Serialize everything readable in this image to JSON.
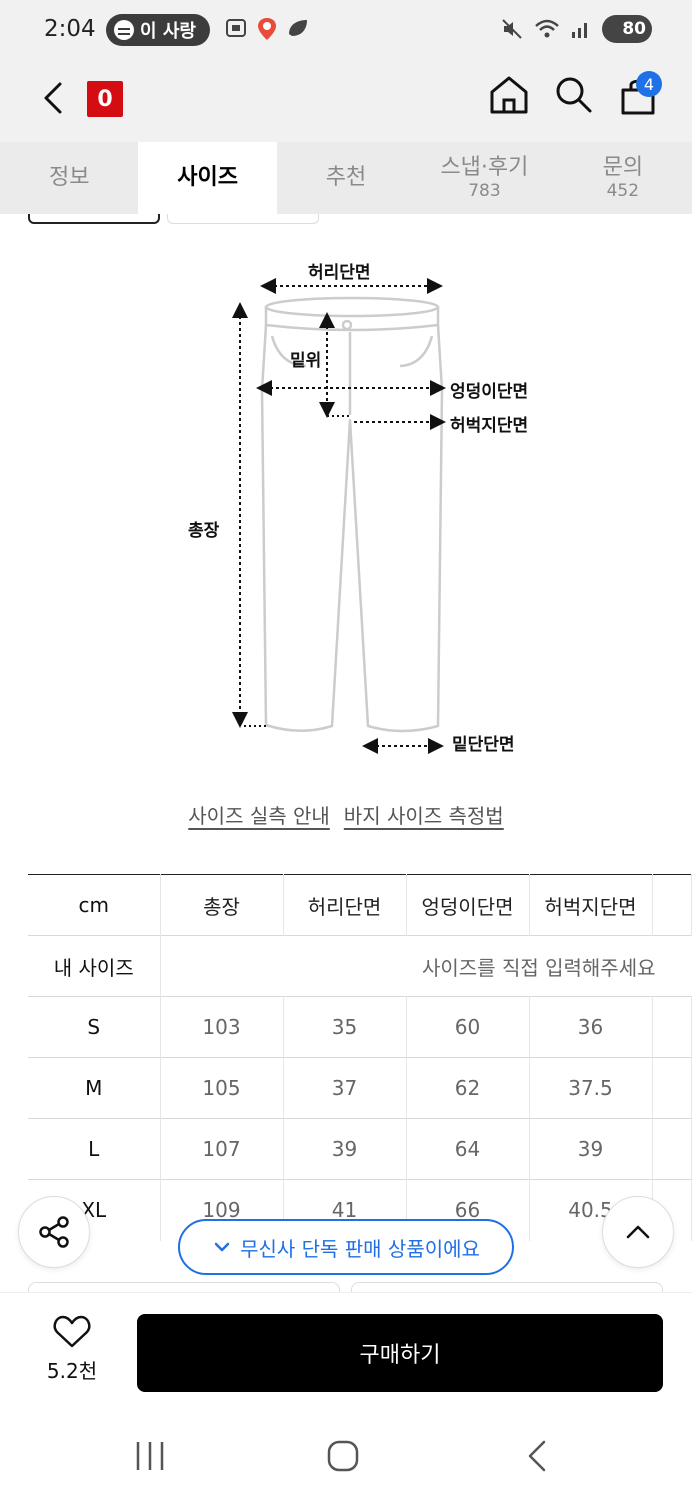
{
  "status_bar": {
    "time": "2:04",
    "media_pill": "이 사랑",
    "battery": "80"
  },
  "header": {
    "brand_logo": "0",
    "cart_count": "4",
    "icons": [
      "back-icon",
      "home-icon",
      "search-icon",
      "shopping-bag-icon"
    ]
  },
  "tabs": [
    {
      "label": "정보",
      "count": ""
    },
    {
      "label": "사이즈",
      "count": "",
      "active": true
    },
    {
      "label": "추천",
      "count": ""
    },
    {
      "label": "스냅·후기",
      "count": "783"
    },
    {
      "label": "문의",
      "count": "452"
    }
  ],
  "diagram": {
    "waist": "허리단면",
    "rise": "밑위",
    "hip": "엉덩이단면",
    "thigh": "허벅지단면",
    "length": "총장",
    "hem": "밑단단면"
  },
  "links": {
    "size_guide": "사이즈 실측 안내",
    "measure_guide": "바지 사이즈 측정법"
  },
  "size_table": {
    "unit": "cm",
    "columns": [
      "총장",
      "허리단면",
      "엉덩이단면",
      "허벅지단면"
    ],
    "my_size_label": "내 사이즈",
    "my_size_placeholder": "사이즈를 직접 입력해주세요",
    "rows": [
      {
        "size": "S",
        "values": [
          "103",
          "35",
          "60",
          "36"
        ]
      },
      {
        "size": "M",
        "values": [
          "105",
          "37",
          "62",
          "37.5"
        ]
      },
      {
        "size": "L",
        "values": [
          "107",
          "39",
          "64",
          "39"
        ]
      },
      {
        "size": "XL",
        "values": [
          "109",
          "41",
          "66",
          "40.5"
        ]
      }
    ]
  },
  "floating": {
    "exclusive_badge": "무신사 단독 판매 상품이에요"
  },
  "bottom_bar": {
    "like_count": "5.2천",
    "buy_label": "구매하기"
  },
  "colors": {
    "accent_blue": "#1f6fe5",
    "brand_red": "#d40d12",
    "buy_button": "#000000"
  }
}
